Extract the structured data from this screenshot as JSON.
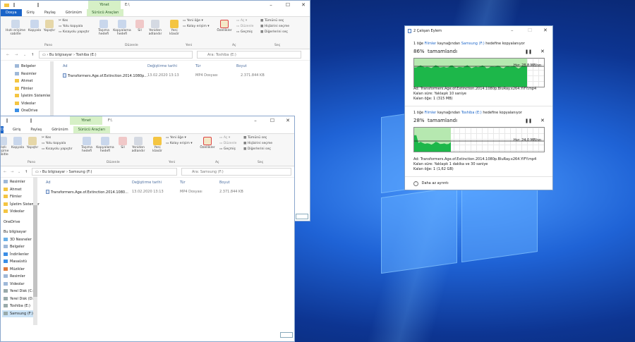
{
  "window_back": {
    "ribbon_ctx_label": "Yönet",
    "title_path": "E:\\",
    "tabs": [
      "Dosya",
      "Giriş",
      "Paylaş",
      "Görünüm",
      "Sürücü Araçları"
    ],
    "ribbon": {
      "pin": "Hızlı erişime sabitle",
      "copy": "Kopyala",
      "paste": "Yapıştır",
      "cut": "Kes",
      "copy_path": "Yolu kopyala",
      "paste_shortcut": "Kısayolu yapıştır",
      "move_to": "Taşıma hedefi",
      "copy_to": "Kopyalama hedefi",
      "delete": "Sil",
      "rename": "Yeniden adlandır",
      "new_folder": "Yeni klasör",
      "new_item": "Yeni öğe",
      "easy_access": "Kolay erişim",
      "properties": "Özellikler",
      "open": "Aç",
      "edit": "Düzenle",
      "history": "Geçmiş",
      "select_all": "Tümünü seç",
      "select_none": "Hiçbirini seçme",
      "invert_select": "Diğerlerini seç",
      "groups": [
        "Pano",
        "Düzenle",
        "Yeni",
        "Aç",
        "Seç"
      ]
    },
    "address": [
      "Bu bilgisayar",
      "Toshiba (E:)"
    ],
    "search_placeholder": "Ara: Toshiba (E:)",
    "nav": [
      "Belgeler",
      "Resimler",
      "Ahmet",
      "Filmler",
      "İşletim Sistemler",
      "Videolar",
      "OneDrive"
    ],
    "columns": [
      "Ad",
      "Değiştirme tarihi",
      "Tür",
      "Boyut"
    ],
    "files": [
      {
        "name": "Transformers.Age.of.Extinction.2014.1080p...",
        "date": "13.02.2020 13:13",
        "type": "MP4 Dosyası",
        "size": "2.371.844 KB"
      }
    ]
  },
  "window_front": {
    "ribbon_ctx_label": "Yönet",
    "title_path": "F:\\",
    "tabs": [
      "Dosya",
      "Giriş",
      "Paylaş",
      "Görünüm",
      "Sürücü Araçları"
    ],
    "address": [
      "Bu bilgisayar",
      "Samsung (F:)"
    ],
    "search_placeholder": "Ara: Samsung (F:)",
    "nav": [
      "Resimler",
      "Ahmet",
      "Filmler",
      "İşletim Sistemler",
      "Videolar",
      "",
      "OneDrive",
      "",
      "Bu bilgisayar",
      "3D Nesneler",
      "Belgeler",
      "İndirilenler",
      "Masaüstü",
      "Müzikler",
      "Resimler",
      "Videolar",
      "Yerel Disk (C:)",
      "Yerel Disk (D:)",
      "Toshiba (E:)",
      "Samsung (F:)"
    ],
    "columns": [
      "Ad",
      "Değiştirme tarihi",
      "Tür",
      "Boyut"
    ],
    "files": [
      {
        "name": "Transformers.Age.of.Extinction.2014.1080...",
        "date": "13.02.2020 13:13",
        "type": "MP4 Dosyası",
        "size": "2.371.844 KB"
      }
    ]
  },
  "dialog": {
    "title": "2 Çalışan Eylem",
    "op1": {
      "line_a": "1 öğe ",
      "src": "Filmler",
      "line_b": " kaynağından ",
      "dst": "Samsung (F:)",
      "line_c": " hedefine kopyalanıyor",
      "percent_text": "86%  tamamlandı",
      "percent": 0.86,
      "speed": "Hız: 28,8 MB/sn",
      "name": "Ad:  Transformers.Age.of.Extinction.2014.1080p.BluRay.x264.YIFY.mp4",
      "remaining": "Kalan süre:  Yaklaşık 10 saniye",
      "items": "Kalan öğe:  1 (315 MB)"
    },
    "op2": {
      "line_a": "1 öğe ",
      "src": "Filmler",
      "line_b": " kaynağından ",
      "dst": "Toshiba (E:)",
      "line_c": " hedefine kopyalanıyor",
      "percent_text": "28%  tamamlandı",
      "percent": 0.28,
      "speed": "Hız: 24,0 MB/sn",
      "name": "Ad:  Transformers.Age.of.Extinction.2014.1080p.BluRay.x264.YIFY.mp4",
      "remaining": "Kalan süre:  Yaklaşık 1 dakika ve 30 saniye",
      "items": "Kalan öğe:  1 (1,62 GB)"
    },
    "less_details": "Daha az ayrıntı"
  }
}
